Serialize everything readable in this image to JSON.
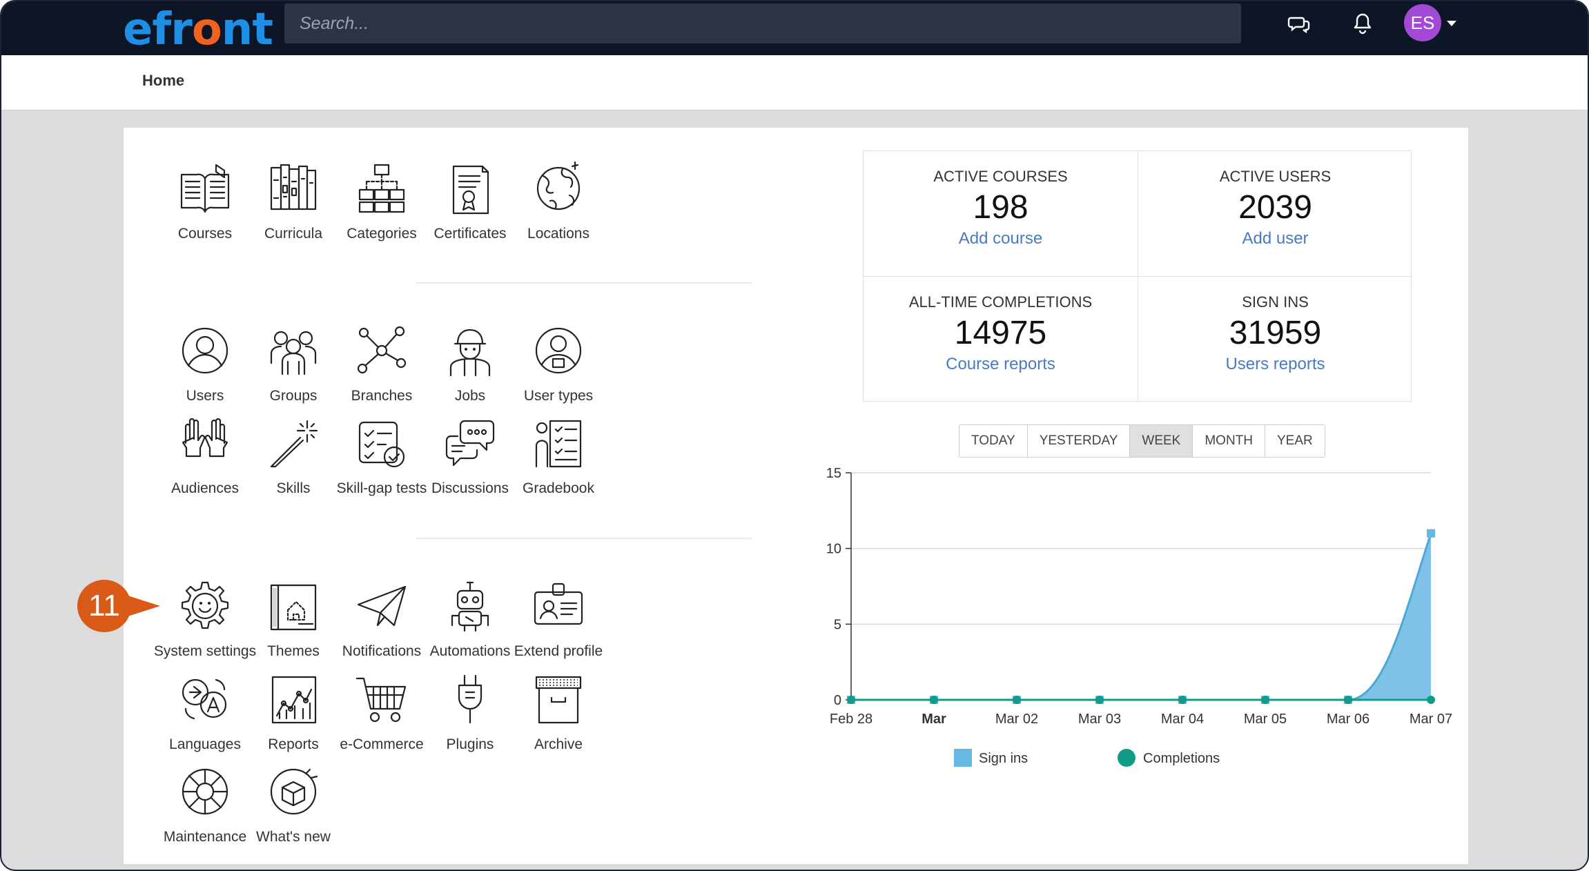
{
  "topbar": {
    "logo": {
      "pre": "efr",
      "o": "o",
      "post": "nt"
    },
    "search_placeholder": "Search...",
    "avatar_initials": "ES",
    "colors": {
      "bar": "#0d1626",
      "logo": "#1f8fe6",
      "logo_accent": "#f0621e",
      "avatar": "#a24ad6"
    }
  },
  "breadcrumb": "Home",
  "groups": {
    "g1": [
      {
        "label": "Courses",
        "icon": "book-icon"
      },
      {
        "label": "Curricula",
        "icon": "bookshelf-icon"
      },
      {
        "label": "Categories",
        "icon": "hierarchy-icon"
      },
      {
        "label": "Certificates",
        "icon": "certificate-icon"
      },
      {
        "label": "Locations",
        "icon": "globe-icon"
      }
    ],
    "g2": [
      {
        "label": "Users",
        "icon": "user-icon"
      },
      {
        "label": "Groups",
        "icon": "group-icon"
      },
      {
        "label": "Branches",
        "icon": "network-icon"
      },
      {
        "label": "Jobs",
        "icon": "worker-icon"
      },
      {
        "label": "User types",
        "icon": "user-badge-icon"
      },
      {
        "label": "Audiences",
        "icon": "raised-hands-icon"
      },
      {
        "label": "Skills",
        "icon": "magic-wand-icon"
      },
      {
        "label": "Skill-gap tests",
        "icon": "checklist-icon"
      },
      {
        "label": "Discussions",
        "icon": "chat-bubbles-icon"
      },
      {
        "label": "Gradebook",
        "icon": "gradebook-icon"
      }
    ],
    "g3": [
      {
        "label": "System settings",
        "icon": "gear-icon"
      },
      {
        "label": "Themes",
        "icon": "blueprint-icon"
      },
      {
        "label": "Notifications",
        "icon": "paper-plane-icon"
      },
      {
        "label": "Automations",
        "icon": "robot-icon"
      },
      {
        "label": "Extend profile",
        "icon": "id-card-icon"
      },
      {
        "label": "Languages",
        "icon": "translate-icon"
      },
      {
        "label": "Reports",
        "icon": "report-chart-icon"
      },
      {
        "label": "e-Commerce",
        "icon": "shopping-cart-icon"
      },
      {
        "label": "Plugins",
        "icon": "plug-icon"
      },
      {
        "label": "Archive",
        "icon": "archive-box-icon"
      },
      {
        "label": "Maintenance",
        "icon": "maintenance-icon"
      },
      {
        "label": "What's new",
        "icon": "new-box-icon"
      }
    ]
  },
  "callout_badge": "11",
  "stats": [
    {
      "heading": "ACTIVE COURSES",
      "value": "198",
      "link": "Add course"
    },
    {
      "heading": "ACTIVE USERS",
      "value": "2039",
      "link": "Add user"
    },
    {
      "heading": "ALL-TIME COMPLETIONS",
      "value": "14975",
      "link": "Course reports"
    },
    {
      "heading": "SIGN INS",
      "value": "31959",
      "link": "Users reports"
    }
  ],
  "range_tabs": [
    "TODAY",
    "YESTERDAY",
    "WEEK",
    "MONTH",
    "YEAR"
  ],
  "range_active": "WEEK",
  "chart_data": {
    "type": "area",
    "categories": [
      "Feb 28",
      "Mar",
      "Mar 02",
      "Mar 03",
      "Mar 04",
      "Mar 05",
      "Mar 06",
      "Mar 07"
    ],
    "series": [
      {
        "name": "Sign ins",
        "values": [
          0,
          0,
          0,
          0,
          0,
          0,
          0,
          11
        ],
        "color": "#67b8e3"
      },
      {
        "name": "Completions",
        "values": [
          0,
          0,
          0,
          0,
          0,
          0,
          0,
          0
        ],
        "color": "#0f9d8a"
      }
    ],
    "ylim": [
      0,
      15
    ],
    "yticks": [
      0,
      5,
      10,
      15
    ],
    "bold_categories": [
      "Mar"
    ],
    "grid": true,
    "legend": "bottom"
  }
}
